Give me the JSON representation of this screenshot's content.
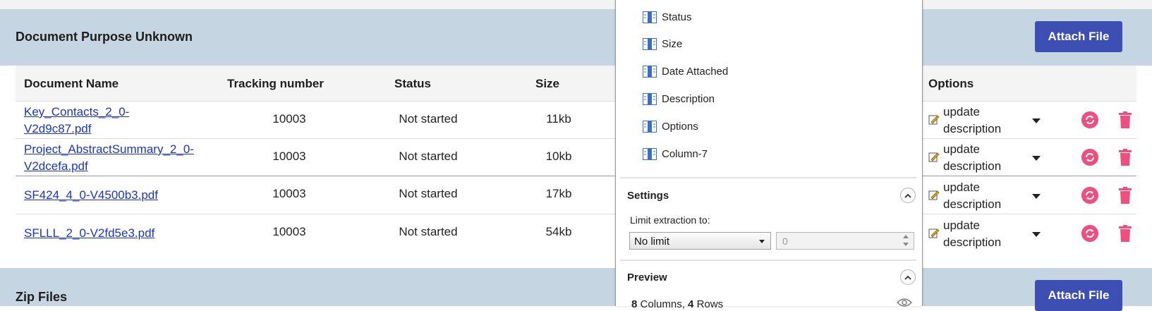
{
  "sections": [
    {
      "title": "Document Purpose Unknown",
      "attach_label": "Attach File"
    },
    {
      "title": "Zip Files",
      "attach_label": "Attach File"
    }
  ],
  "table": {
    "headers": {
      "name": "Document Name",
      "tracking": "Tracking number",
      "status": "Status",
      "size": "Size",
      "options": "Options"
    },
    "rows": [
      {
        "name": "Key_Contacts_2_0-V2d9c87.pdf",
        "name_line1": "Key_Contacts_2_0-",
        "name_line2": "V2d9c87.pdf",
        "tracking": "10003",
        "status": "Not started",
        "size": "11kb",
        "option_line1": "update",
        "option_line2": "description"
      },
      {
        "name": "Project_AbstractSummary_2_0-V2dcefa.pdf",
        "name_line1": "Project_AbstractSummary_2_0-",
        "name_line2": "V2dcefa.pdf",
        "tracking": "10003",
        "status": "Not started",
        "size": "10kb",
        "option_line1": "update",
        "option_line2": "description"
      },
      {
        "name": "SF424_4_0-V4500b3.pdf",
        "name_line1": "SF424_4_0-V4500b3.pdf",
        "name_line2": "",
        "tracking": "10003",
        "status": "Not started",
        "size": "17kb",
        "option_line1": "update",
        "option_line2": "description"
      },
      {
        "name": "SFLLL_2_0-V2fd5e3.pdf",
        "name_line1": "SFLLL_2_0-V2fd5e3.pdf",
        "name_line2": "",
        "tracking": "10003",
        "status": "Not started",
        "size": "54kb",
        "option_line1": "update",
        "option_line2": "description"
      }
    ]
  },
  "panel": {
    "columns": [
      "Status",
      "Size",
      "Date Attached",
      "Description",
      "Options",
      "Column-7"
    ],
    "settings": {
      "title": "Settings",
      "limit_label": "Limit extraction to:",
      "limit_select": "No limit",
      "limit_value": "0"
    },
    "preview": {
      "title": "Preview",
      "columns_count": "8",
      "columns_word": "Columns",
      "rows_count": "4",
      "rows_word": "Rows"
    }
  },
  "colors": {
    "section_header_bg": "#c5d5e1",
    "attach_button_bg": "#3d4fb2",
    "link": "#1a33cc",
    "action_pink": "#ee4f7e",
    "column_icon_blue": "#3a6fc4"
  }
}
